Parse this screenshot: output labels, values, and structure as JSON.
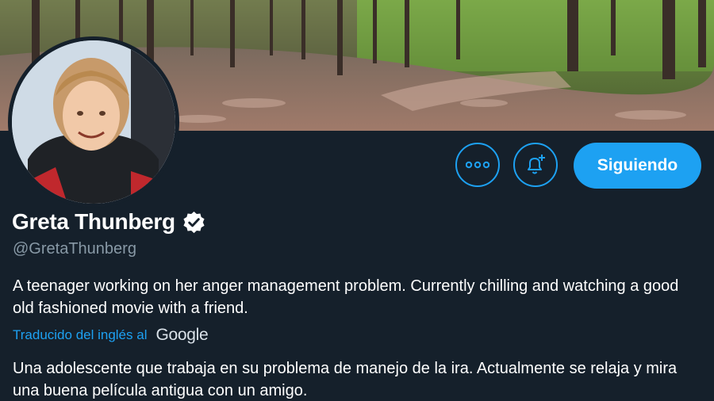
{
  "profile": {
    "display_name": "Greta Thunberg",
    "handle": "@GretaThunberg",
    "verified": true,
    "bio": "A teenager working on her anger management problem. Currently chilling and watching a good old fashioned movie with a friend."
  },
  "actions": {
    "more_icon": "more-icon",
    "notify_icon": "bell-plus-icon",
    "follow_label": "Siguiendo"
  },
  "translation": {
    "link_label": "Traducido del inglés al",
    "provider": "Google",
    "text": "Una adolescente que trabaja en su problema de manejo de la ira. Actualmente se relaja y mira una buena película antigua con un amigo."
  },
  "colors": {
    "background": "#15202b",
    "accent": "#1da1f2",
    "secondary_text": "#8899a6"
  }
}
